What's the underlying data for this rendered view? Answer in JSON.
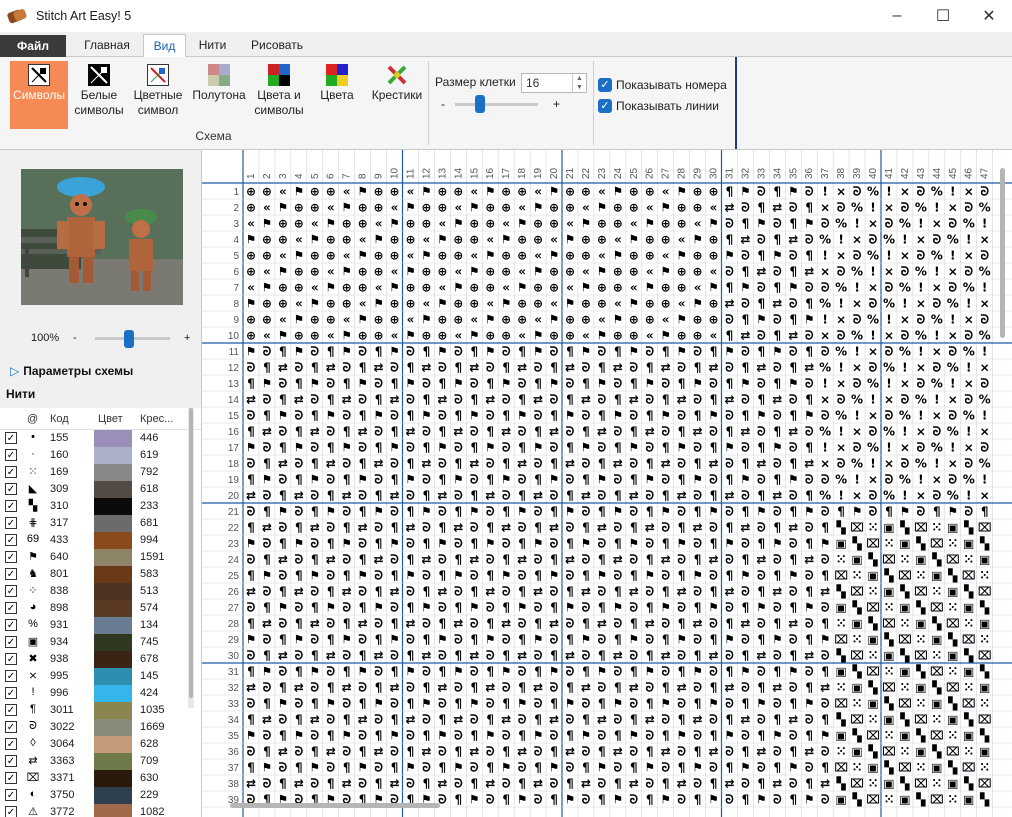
{
  "window": {
    "title": "Stitch Art Easy! 5"
  },
  "menu": {
    "tabs": [
      "Файл",
      "Главная",
      "Вид",
      "Нити",
      "Рисовать"
    ]
  },
  "ribbon": {
    "buttons": [
      {
        "line1": "Символы",
        "line2": ""
      },
      {
        "line1": "Белые",
        "line2": "символы"
      },
      {
        "line1": "Цветные",
        "line2": "символ"
      },
      {
        "line1": "Полутона",
        "line2": ""
      },
      {
        "line1": "Цвета и",
        "line2": "символы"
      },
      {
        "line1": "Цвета",
        "line2": ""
      },
      {
        "line1": "Крестики",
        "line2": ""
      }
    ],
    "group_label": "Схема",
    "cell_size_label": "Размер клетки",
    "cell_size_value": "16",
    "cell_slider_min": "-",
    "cell_slider_max": "+",
    "cell_slider_level": 0.3,
    "show_numbers": "Показывать номера",
    "show_lines": "Показывать линии"
  },
  "left": {
    "zoom_value": "100%",
    "zoom_minus": "-",
    "zoom_plus": "+",
    "zoom_level": 0.45,
    "params_label": "Параметры схемы",
    "threads_label": "Нити",
    "table_headers": {
      "symbol": "@",
      "code": "Код",
      "color": "Цвет",
      "count": "Крес..."
    },
    "splitter_arrow": "<",
    "threads": [
      {
        "sym": "•",
        "code": "155",
        "color": "#9a8fb8",
        "count": "446"
      },
      {
        "sym": "·",
        "code": "160",
        "color": "#a9b0c8",
        "count": "619"
      },
      {
        "sym": "⁙",
        "code": "169",
        "color": "#888888",
        "count": "792"
      },
      {
        "sym": "◣",
        "code": "309",
        "color": "#534a45",
        "count": "618"
      },
      {
        "sym": "▚",
        "code": "310",
        "color": "#0b0b0b",
        "count": "233"
      },
      {
        "sym": "⋕",
        "code": "317",
        "color": "#6b6b6b",
        "count": "681"
      },
      {
        "sym": "69",
        "code": "433",
        "color": "#8a4a1c",
        "count": "994"
      },
      {
        "sym": "⚑",
        "code": "640",
        "color": "#8e8468",
        "count": "1591"
      },
      {
        "sym": "♞",
        "code": "801",
        "color": "#6a3a18",
        "count": "583"
      },
      {
        "sym": "⁘",
        "code": "838",
        "color": "#4e3323",
        "count": "513"
      },
      {
        "sym": "◕",
        "code": "898",
        "color": "#5a3a22",
        "count": "574"
      },
      {
        "sym": "%",
        "code": "931",
        "color": "#6a7c92",
        "count": "134"
      },
      {
        "sym": "▣",
        "code": "934",
        "color": "#2f3820",
        "count": "745"
      },
      {
        "sym": "✖",
        "code": "938",
        "color": "#3a2514",
        "count": "678"
      },
      {
        "sym": "⨯",
        "code": "995",
        "color": "#2c8fb0",
        "count": "145"
      },
      {
        "sym": "!",
        "code": "996",
        "color": "#35b6ea",
        "count": "424"
      },
      {
        "sym": "¶",
        "code": "3011",
        "color": "#8a8450",
        "count": "1035"
      },
      {
        "sym": "ᘐ",
        "code": "3022",
        "color": "#8a8a78",
        "count": "1669"
      },
      {
        "sym": "◊",
        "code": "3064",
        "color": "#c49a78",
        "count": "628"
      },
      {
        "sym": "⇄",
        "code": "3363",
        "color": "#6e7a4a",
        "count": "709"
      },
      {
        "sym": "⌧",
        "code": "3371",
        "color": "#2a1a0c",
        "count": "630"
      },
      {
        "sym": "◐",
        "code": "3750",
        "color": "#2e4050",
        "count": "229"
      },
      {
        "sym": "⚠",
        "code": "3772",
        "color": "#a06a4a",
        "count": "1082"
      }
    ]
  },
  "grid": {
    "col_numbers": [
      "1",
      "2",
      "3",
      "4",
      "5",
      "6",
      "7",
      "8",
      "9",
      "10",
      "11",
      "12",
      "13",
      "14",
      "15",
      "16",
      "17",
      "18",
      "19",
      "20",
      "21",
      "22",
      "23",
      "24",
      "25",
      "26",
      "27",
      "28",
      "29",
      "30",
      "31",
      "32",
      "33",
      "34",
      "35",
      "36",
      "37",
      "38",
      "39",
      "40",
      "41",
      "42",
      "43",
      "44",
      "45",
      "46",
      "47"
    ],
    "row_numbers": [
      "1",
      "2",
      "3",
      "4",
      "5",
      "6",
      "7",
      "8",
      "9",
      "10",
      "11",
      "12",
      "13",
      "14",
      "15",
      "16",
      "17",
      "18",
      "19",
      "20",
      "21",
      "22",
      "23",
      "24",
      "25",
      "26",
      "27",
      "28",
      "29",
      "30",
      "31",
      "32",
      "33",
      "34",
      "35",
      "36",
      "37",
      "38",
      "39"
    ]
  },
  "colors": {
    "accent": "#1c6fc4",
    "selected_button": "#f58a55",
    "grid_major": "#1e5aa8",
    "grid_minor": "#cfd6e0"
  }
}
